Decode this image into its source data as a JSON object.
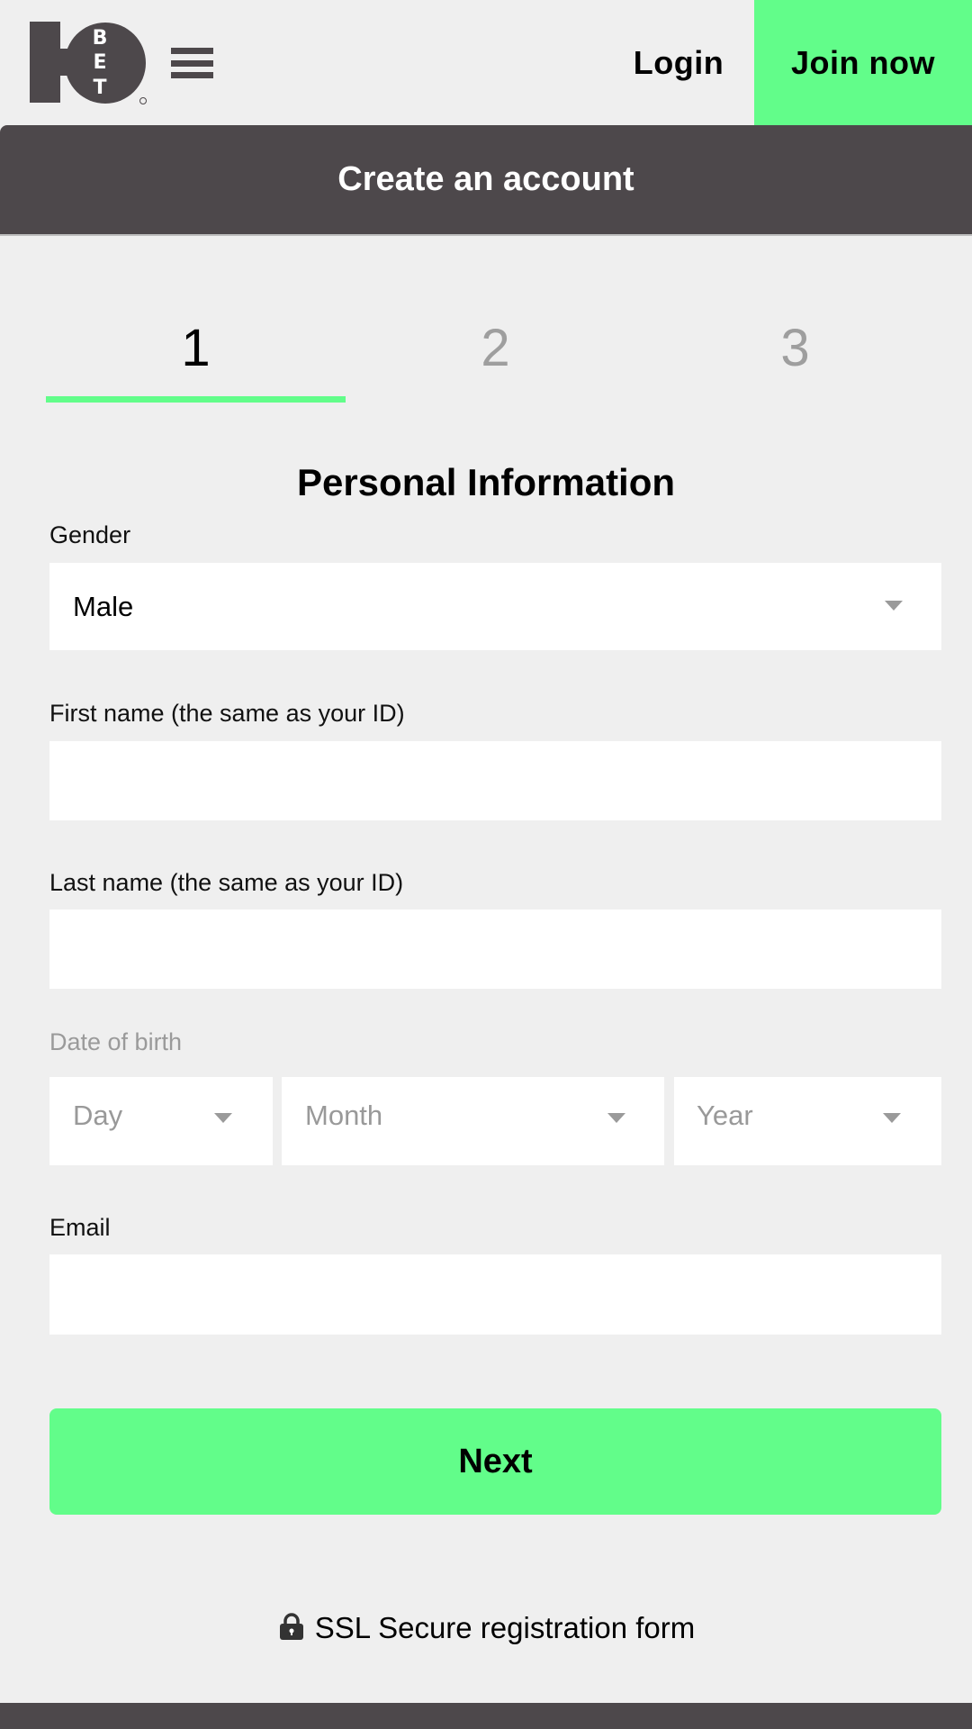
{
  "header": {
    "logo_text": "10BET",
    "logo_letters": [
      "B",
      "E",
      "T"
    ],
    "menu_icon": "hamburger-menu-icon",
    "login_label": "Login",
    "join_label": "Join now"
  },
  "title_bar": {
    "title": "Create an account"
  },
  "steps": {
    "items": [
      {
        "label": "1",
        "active": true
      },
      {
        "label": "2",
        "active": false
      },
      {
        "label": "3",
        "active": false
      }
    ],
    "current_step": 1,
    "total_steps": 3
  },
  "form": {
    "section_title": "Personal Information",
    "gender": {
      "label": "Gender",
      "value": "Male"
    },
    "first_name": {
      "label": "First name (the same as your ID)",
      "value": ""
    },
    "last_name": {
      "label": "Last name (the same as your ID)",
      "value": ""
    },
    "date_of_birth": {
      "label": "Date of birth",
      "day_placeholder": "Day",
      "month_placeholder": "Month",
      "year_placeholder": "Year"
    },
    "email": {
      "label": "Email",
      "value": ""
    },
    "next_label": "Next"
  },
  "footer": {
    "ssl_icon": "lock-icon",
    "ssl_text": "SSL Secure registration form"
  },
  "colors": {
    "accent_green": "#62fd8a",
    "dark_bar": "#4d484b",
    "background": "#efefef",
    "muted_text": "#9e9e9e"
  }
}
